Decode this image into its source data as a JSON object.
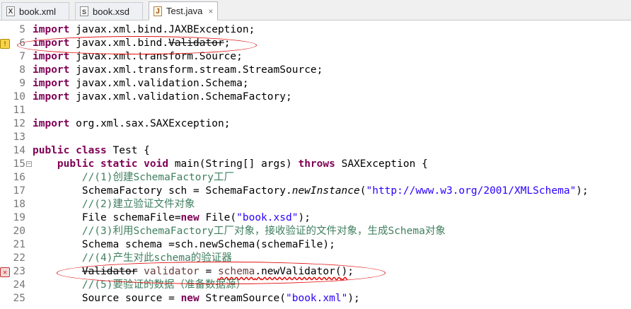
{
  "tabs": [
    {
      "label": "book.xml",
      "icon": "xml-file-icon",
      "glyph": "X"
    },
    {
      "label": "book.xsd",
      "icon": "xsd-file-icon",
      "glyph": "S"
    },
    {
      "label": "Test.java",
      "icon": "java-file-icon",
      "glyph": "J",
      "active": true,
      "close": "×"
    }
  ],
  "lines": [
    {
      "n": "5",
      "code": "import javax.xml.bind.JAXBException;"
    },
    {
      "n": "6",
      "code": "import javax.xml.bind.Validator;",
      "marker": "warning"
    },
    {
      "n": "7",
      "code": "import javax.xml.transform.Source;"
    },
    {
      "n": "8",
      "code": "import javax.xml.transform.stream.StreamSource;"
    },
    {
      "n": "9",
      "code": "import javax.xml.validation.Schema;"
    },
    {
      "n": "10",
      "code": "import javax.xml.validation.SchemaFactory;"
    },
    {
      "n": "11",
      "code": ""
    },
    {
      "n": "12",
      "code": "import org.xml.sax.SAXException;"
    },
    {
      "n": "13",
      "code": ""
    },
    {
      "n": "14",
      "code": "public class Test {"
    },
    {
      "n": "15",
      "code": "    public static void main(String[] args) throws SAXException {",
      "fold": true
    },
    {
      "n": "16",
      "code": "        //(1)创建SchemaFactory工厂"
    },
    {
      "n": "17",
      "code": "        SchemaFactory sch = SchemaFactory.newInstance(\"http://www.w3.org/2001/XMLSchema\");"
    },
    {
      "n": "18",
      "code": "        //(2)建立验证文件对象"
    },
    {
      "n": "19",
      "code": "        File schemaFile=new File(\"book.xsd\");"
    },
    {
      "n": "20",
      "code": "        //(3)利用SchemaFactory工厂对象，接收验证的文件对象，生成Schema对象"
    },
    {
      "n": "21",
      "code": "        Schema schema =sch.newSchema(schemaFile);"
    },
    {
      "n": "22",
      "code": "        //(4)产生对此schema的验证器"
    },
    {
      "n": "23",
      "code": "        Validator validator = schema.newValidator();",
      "marker": "error"
    },
    {
      "n": "24",
      "code": "        //(5)要验证的数据（准备数据源）"
    },
    {
      "n": "25",
      "code": "        Source source = new StreamSource(\"book.xml\");"
    }
  ],
  "colors": {
    "keyword": "#7f0055",
    "string": "#2a00ff",
    "comment": "#3f7f5f",
    "annotation": "#e01010"
  }
}
